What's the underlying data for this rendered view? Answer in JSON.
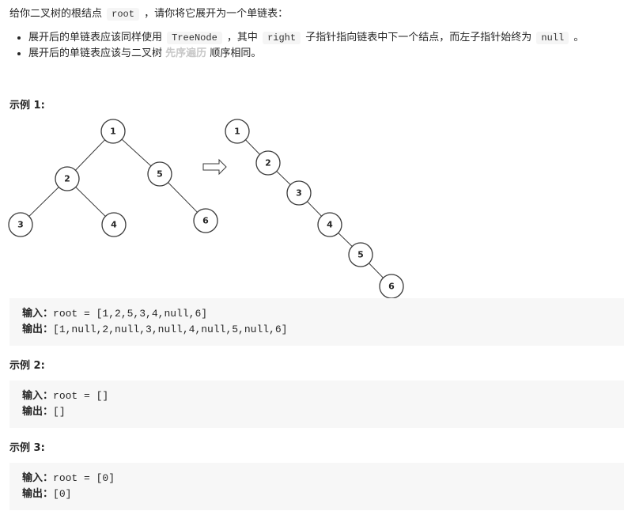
{
  "intro": {
    "before": "给你二叉树的根结点",
    "code": "root",
    "after": "，请你将它展开为一个单链表："
  },
  "bullets": [
    {
      "p1": "展开后的单链表应该同样使用",
      "c1": "TreeNode",
      "p2": "，其中",
      "c2": "right",
      "p3": "子指针指向链表中下一个结点，而左子指针始终为",
      "c3": "null",
      "p4": "。"
    },
    {
      "p1": "展开后的单链表应该与二叉树",
      "strong": "先序遍历",
      "p2": "顺序相同。"
    }
  ],
  "examples": [
    {
      "title": "示例 1:",
      "input_label": "输入：",
      "input": "root = [1,2,5,3,4,null,6]",
      "output_label": "输出：",
      "output": "[1,null,2,null,3,null,4,null,5,null,6]"
    },
    {
      "title": "示例 2:",
      "input_label": "输入：",
      "input": "root = []",
      "output_label": "输出：",
      "output": "[]"
    },
    {
      "title": "示例 3:",
      "input_label": "输入：",
      "input": "root = [0]",
      "output_label": "输出：",
      "output": "[0]"
    }
  ],
  "diagram": {
    "tree_nodes": [
      "1",
      "2",
      "5",
      "3",
      "4",
      "6"
    ],
    "list_nodes": [
      "1",
      "2",
      "3",
      "4",
      "5",
      "6"
    ]
  }
}
